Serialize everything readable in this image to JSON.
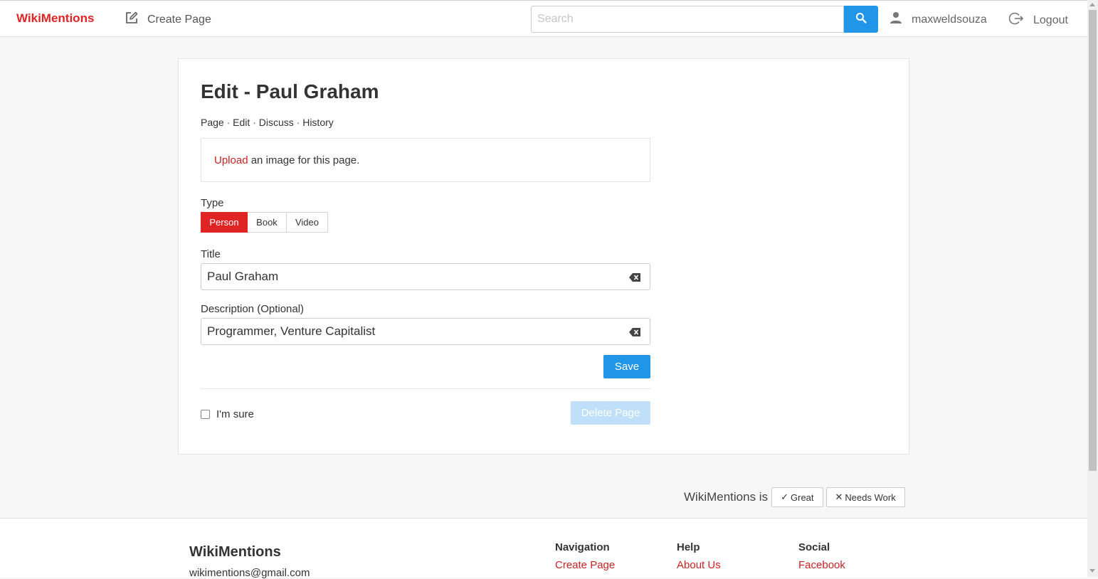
{
  "header": {
    "brand": "WikiMentions",
    "create_page": "Create Page",
    "search_placeholder": "Search",
    "username": "maxweldsouza",
    "logout": "Logout"
  },
  "edit": {
    "title": "Edit - Paul Graham",
    "subnav": [
      "Page",
      "Edit",
      "Discuss",
      "History"
    ],
    "subnav_sep": "·",
    "upload_link": "Upload",
    "upload_text": " an image for this page.",
    "type_label": "Type",
    "types": [
      "Person",
      "Book",
      "Video"
    ],
    "selected_type": "Person",
    "title_label": "Title",
    "title_value": "Paul Graham",
    "description_label": "Description (Optional)",
    "description_value": "Programmer, Venture Capitalist",
    "save": "Save",
    "confirm_label": "I'm sure",
    "confirm_checked": false,
    "delete": "Delete Page"
  },
  "feedback": {
    "prefix": "WikiMentions is",
    "great": "Great",
    "needs_work": "Needs Work"
  },
  "footer": {
    "brand": "WikiMentions",
    "email": "wikimentions@gmail.com",
    "columns": [
      {
        "heading": "Navigation",
        "link": "Create Page"
      },
      {
        "heading": "Help",
        "link": "About Us"
      },
      {
        "heading": "Social",
        "link": "Facebook"
      }
    ]
  },
  "colors": {
    "brand_red": "#e02424",
    "primary_blue": "#2196e8",
    "disabled_blue": "#bfe0f8"
  },
  "icons": {
    "create": "edit-icon",
    "search": "search-icon",
    "user": "user-icon",
    "logout": "logout-icon",
    "clear": "backspace-icon"
  }
}
